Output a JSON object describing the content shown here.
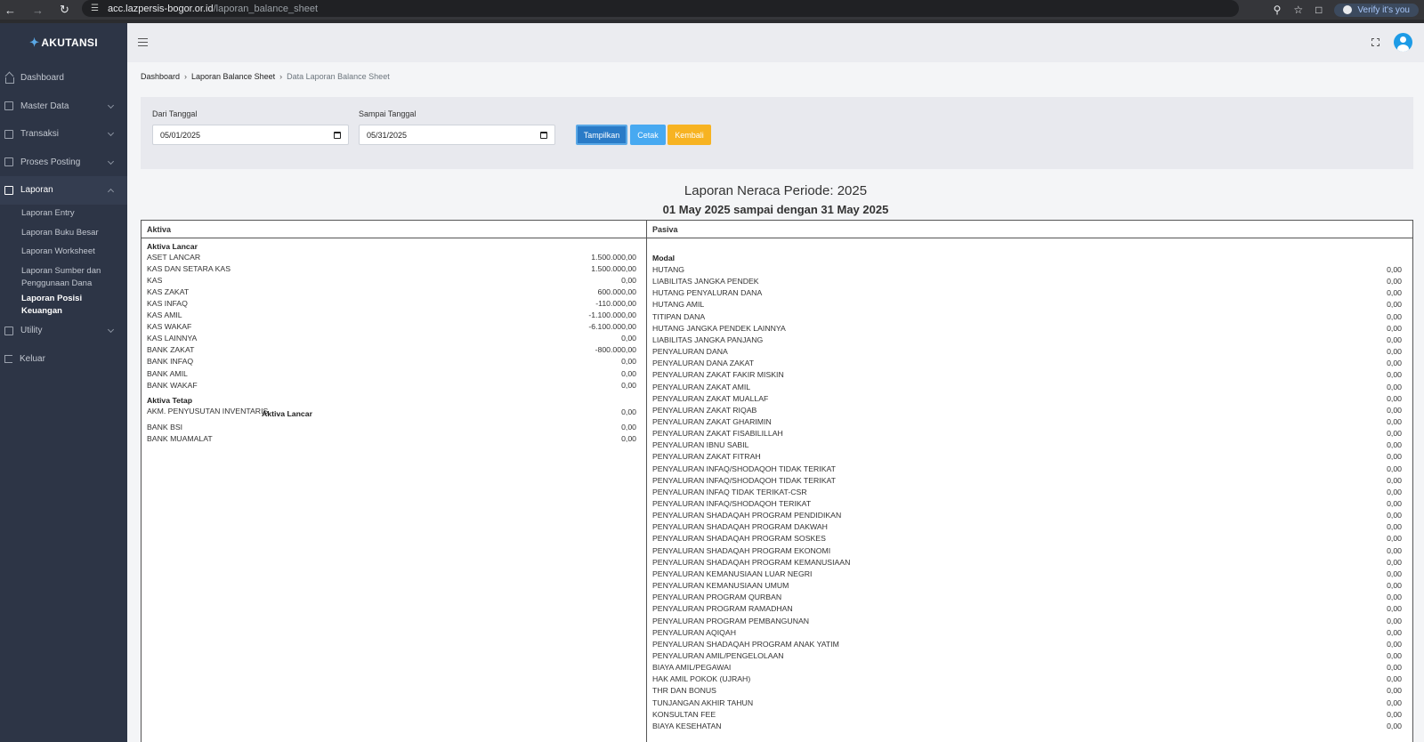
{
  "browser": {
    "url_host": "acc.lazpersis-bogor.or.id",
    "url_path": "/laporan_balance_sheet",
    "verify_label": "Verify it's you"
  },
  "sidebar": {
    "brand": "AKUTANSI",
    "items": [
      {
        "label": "Dashboard"
      },
      {
        "label": "Master Data"
      },
      {
        "label": "Transaksi"
      },
      {
        "label": "Proses Posting"
      },
      {
        "label": "Laporan"
      },
      {
        "label": "Utility"
      },
      {
        "label": "Keluar"
      }
    ],
    "laporan_sub": [
      {
        "label": "Laporan Entry"
      },
      {
        "label": "Laporan Buku Besar"
      },
      {
        "label": "Laporan Worksheet"
      },
      {
        "label": "Laporan Sumber dan Penggunaan Dana"
      },
      {
        "label": "Laporan Posisi Keuangan"
      }
    ]
  },
  "breadcrumb": [
    "Dashboard",
    "Laporan Balance Sheet",
    "Data Laporan Balance Sheet"
  ],
  "filter": {
    "from_label": "Dari Tanggal",
    "from_value": "05/01/2025",
    "to_label": "Sampai Tanggal",
    "to_value": "05/31/2025",
    "show_label": "Tampilkan",
    "print_label": "Cetak",
    "back_label": "Kembali"
  },
  "report": {
    "title": "Laporan Neraca Periode: 2025",
    "subtitle": "01 May 2025 sampai dengan 31 May 2025",
    "aktiva_header": "Aktiva",
    "pasiva_header": "Pasiva",
    "aktiva_lancar_title": "Aktiva Lancar",
    "aktiva_lancar": [
      {
        "name": "ASET LANCAR",
        "value": "1.500.000,00"
      },
      {
        "name": "KAS DAN SETARA KAS",
        "value": "1.500.000,00"
      },
      {
        "name": "KAS",
        "value": "0,00"
      },
      {
        "name": "KAS ZAKAT",
        "value": "600.000,00"
      },
      {
        "name": "KAS INFAQ",
        "value": "-110.000,00"
      },
      {
        "name": "KAS AMIL",
        "value": "-1.100.000,00"
      },
      {
        "name": "KAS WAKAF",
        "value": "-6.100.000,00"
      },
      {
        "name": "KAS LAINNYA",
        "value": "0,00"
      },
      {
        "name": "BANK ZAKAT",
        "value": "-800.000,00"
      },
      {
        "name": "BANK INFAQ",
        "value": "0,00"
      },
      {
        "name": "BANK AMIL",
        "value": "0,00"
      },
      {
        "name": "BANK WAKAF",
        "value": "0,00"
      }
    ],
    "aktiva_tetap_title": "Aktiva Tetap",
    "aktiva_tetap": [
      {
        "name": "AKM. PENYUSUTAN INVENTARIS",
        "value": "0,00"
      },
      {
        "name": "BANK BSI",
        "value": "0,00"
      },
      {
        "name": "BANK MUAMALAT",
        "value": "0,00"
      }
    ],
    "stray_label": "Aktiva Lancar",
    "modal_title": "Modal",
    "pasiva": [
      {
        "name": "HUTANG",
        "value": "0,00"
      },
      {
        "name": "LIABILITAS JANGKA PENDEK",
        "value": "0,00"
      },
      {
        "name": "HUTANG PENYALURAN DANA",
        "value": "0,00"
      },
      {
        "name": "HUTANG AMIL",
        "value": "0,00"
      },
      {
        "name": "TITIPAN DANA",
        "value": "0,00"
      },
      {
        "name": "HUTANG JANGKA PENDEK LAINNYA",
        "value": "0,00"
      },
      {
        "name": "LIABILITAS JANGKA PANJANG",
        "value": "0,00"
      },
      {
        "name": "PENYALURAN DANA",
        "value": "0,00"
      },
      {
        "name": "PENYALURAN DANA ZAKAT",
        "value": "0,00"
      },
      {
        "name": "PENYALURAN ZAKAT FAKIR MISKIN",
        "value": "0,00"
      },
      {
        "name": "PENYALURAN ZAKAT AMIL",
        "value": "0,00"
      },
      {
        "name": "PENYALURAN ZAKAT MUALLAF",
        "value": "0,00"
      },
      {
        "name": "PENYALURAN ZAKAT RIQAB",
        "value": "0,00"
      },
      {
        "name": "PENYALURAN ZAKAT GHARIMIN",
        "value": "0,00"
      },
      {
        "name": "PENYALURAN ZAKAT FISABILILLAH",
        "value": "0,00"
      },
      {
        "name": "PENYALURAN IBNU SABIL",
        "value": "0,00"
      },
      {
        "name": "PENYALURAN ZAKAT FITRAH",
        "value": "0,00"
      },
      {
        "name": "PENYALURAN INFAQ/SHODAQOH TIDAK TERIKAT",
        "value": "0,00"
      },
      {
        "name": "PENYALURAN INFAQ/SHODAQOH TIDAK TERIKAT",
        "value": "0,00"
      },
      {
        "name": "PENYALURAN INFAQ TIDAK TERIKAT-CSR",
        "value": "0,00"
      },
      {
        "name": "PENYALURAN INFAQ/SHODAQOH TERIKAT",
        "value": "0,00"
      },
      {
        "name": "PENYALURAN SHADAQAH PROGRAM PENDIDIKAN",
        "value": "0,00"
      },
      {
        "name": "PENYALURAN SHADAQAH PROGRAM DAKWAH",
        "value": "0,00"
      },
      {
        "name": "PENYALURAN SHADAQAH PROGRAM SOSKES",
        "value": "0,00"
      },
      {
        "name": "PENYALURAN SHADAQAH PROGRAM EKONOMI",
        "value": "0,00"
      },
      {
        "name": "PENYALURAN SHADAQAH PROGRAM KEMANUSIAAN",
        "value": "0,00"
      },
      {
        "name": "PENYALURAN KEMANUSIAAN LUAR NEGRI",
        "value": "0,00"
      },
      {
        "name": "PENYALURAN KEMANUSIAAN UMUM",
        "value": "0,00"
      },
      {
        "name": "PENYALURAN PROGRAM QURBAN",
        "value": "0,00"
      },
      {
        "name": "PENYALURAN PROGRAM RAMADHAN",
        "value": "0,00"
      },
      {
        "name": "PENYALURAN PROGRAM PEMBANGUNAN",
        "value": "0,00"
      },
      {
        "name": "PENYALURAN AQIQAH",
        "value": "0,00"
      },
      {
        "name": "PENYALURAN SHADAQAH PROGRAM ANAK YATIM",
        "value": "0,00"
      },
      {
        "name": "PENYALURAN AMIL/PENGELOLAAN",
        "value": "0,00"
      },
      {
        "name": "BIAYA AMIL/PEGAWAI",
        "value": "0,00"
      },
      {
        "name": "HAK AMIL POKOK (UJRAH)",
        "value": "0,00"
      },
      {
        "name": "THR DAN BONUS",
        "value": "0,00"
      },
      {
        "name": "TUNJANGAN AKHIR TAHUN",
        "value": "0,00"
      },
      {
        "name": "KONSULTAN FEE",
        "value": "0,00"
      },
      {
        "name": "BIAYA KESEHATAN",
        "value": "0,00"
      }
    ]
  }
}
